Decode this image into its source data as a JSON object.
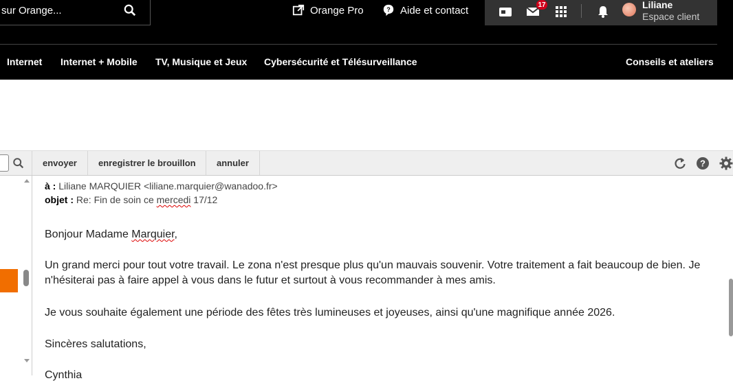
{
  "search": {
    "placeholder": "sur Orange..."
  },
  "toplinks": {
    "orange_pro": "Orange Pro",
    "aide": "Aide et contact"
  },
  "user": {
    "name": "Liliane",
    "subtitle": "Espace client",
    "mail_count": "17"
  },
  "nav": {
    "items": [
      "Internet",
      "Internet + Mobile",
      "TV, Musique et Jeux",
      "Cybersécurité et Télésurveillance",
      "Conseils et ateliers"
    ]
  },
  "toolbar": {
    "send": "envoyer",
    "save_draft": "enregistrer le brouillon",
    "cancel": "annuler"
  },
  "mail": {
    "to_label": "à :",
    "to_value": "Liliane MARQUIER <liliane.marquier@wanadoo.fr>",
    "subject_label": "objet :",
    "subject_pre": "Re: Fin de soin ce ",
    "subject_word": "mercedi",
    "subject_post": " 17/12",
    "greeting_pre": "Bonjour Madame ",
    "greeting_name": "Marquier",
    "greeting_post": ",",
    "para1": "Un grand merci pour tout votre travail. Le zona n'est presque plus qu'un mauvais souvenir. Votre traitement a fait beaucoup de bien. Je n'hésiterai pas à faire appel à vous dans le futur et surtout à vous recommander à mes amis.",
    "para2": "Je vous souhaite également une période des fêtes très lumineuses et joyeuses, ainsi qu'une magnifique année 2026.",
    "closing": "Sincères salutations,",
    "signature": "Cynthia"
  },
  "colors": {
    "accent": "#f16e00",
    "badge": "#d0021b",
    "header_bg": "#000000",
    "toolbar_bg": "#efefef"
  }
}
